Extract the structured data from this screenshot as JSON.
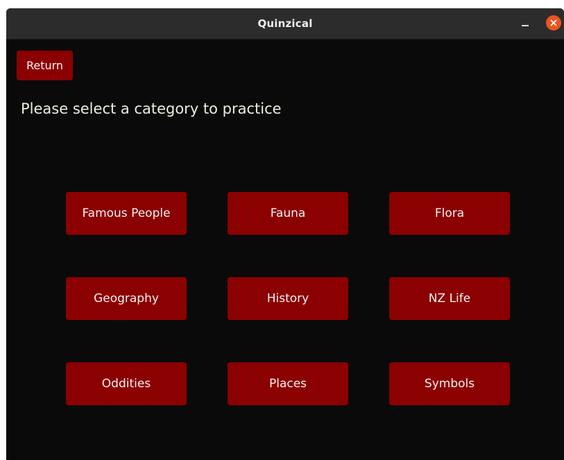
{
  "window": {
    "title": "Quinzical"
  },
  "icons": {
    "minimize": "minimize-icon",
    "close": "close-icon"
  },
  "colors": {
    "background": "#0a0a0a",
    "button": "#8b0000",
    "close": "#e95420",
    "prompt_text": "#e8f0e0"
  },
  "toolbar": {
    "return_label": "Return"
  },
  "main": {
    "prompt": "Please select a category to practice",
    "categories": [
      {
        "label": "Famous People"
      },
      {
        "label": "Fauna"
      },
      {
        "label": "Flora"
      },
      {
        "label": "Geography"
      },
      {
        "label": "History"
      },
      {
        "label": "NZ Life"
      },
      {
        "label": "Oddities"
      },
      {
        "label": "Places"
      },
      {
        "label": "Symbols"
      }
    ]
  }
}
